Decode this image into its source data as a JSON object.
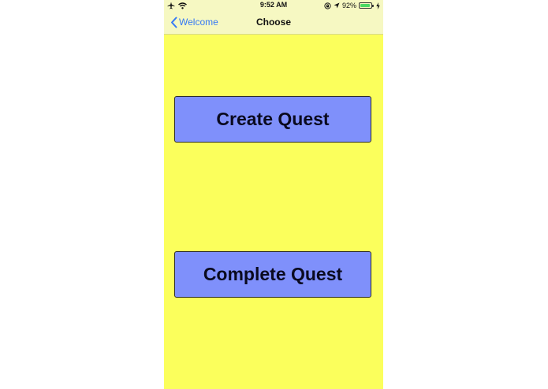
{
  "status_bar": {
    "time": "9:52 AM",
    "battery_percent": "92%",
    "battery_level": 0.92,
    "icons": [
      "airplane-icon",
      "wifi-icon",
      "orientation-lock-icon",
      "location-arrow-icon",
      "battery-icon",
      "charging-bolt-icon"
    ]
  },
  "nav": {
    "back_label": "Welcome",
    "title": "Choose"
  },
  "buttons": {
    "create_label": "Create Quest",
    "complete_label": "Complete Quest"
  },
  "colors": {
    "background": "#fbff5c",
    "nav_background": "#f6f8c2",
    "button_fill": "#7f90fb",
    "link": "#3478f6",
    "battery_fill": "#4cd964"
  }
}
